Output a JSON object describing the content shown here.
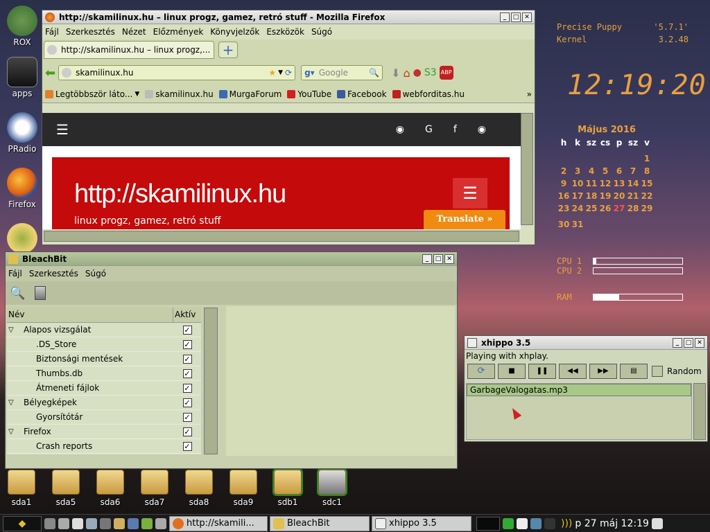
{
  "desktop": {
    "icons": [
      {
        "label": "ROX"
      },
      {
        "label": "apps"
      },
      {
        "label": "PRadio"
      },
      {
        "label": "Firefox"
      }
    ],
    "drives": [
      "sda1",
      "sda5",
      "sda6",
      "sda7",
      "sda8",
      "sda9",
      "sdb1",
      "sdc1"
    ]
  },
  "conky": {
    "os_name": "Precise Puppy",
    "os_version": "'5.7.1'",
    "kernel_label": "Kernel",
    "kernel_version": "3.2.48",
    "clock": "12:19:20",
    "calendar_title": "Május  2016",
    "weekdays": [
      "h",
      "k",
      "sz",
      "cs",
      "p",
      "sz",
      "v"
    ],
    "weeks": [
      [
        "",
        "",
        "",
        "",
        "",
        "",
        "1"
      ],
      [
        "2",
        "3",
        "4",
        "5",
        "6",
        "7",
        "8"
      ],
      [
        "9",
        "10",
        "11",
        "12",
        "13",
        "14",
        "15"
      ],
      [
        "16",
        "17",
        "18",
        "19",
        "20",
        "21",
        "22"
      ],
      [
        "23",
        "24",
        "25",
        "26",
        "27",
        "28",
        "29"
      ],
      [
        "30",
        "31",
        "",
        "",
        "",
        "",
        ""
      ]
    ],
    "today": "27",
    "cpu1_label": "CPU 1",
    "cpu2_label": "CPU 2",
    "ram_label": "RAM",
    "cpu1_usage": 0.03,
    "cpu2_usage": 0.0,
    "ram_usage": 0.29
  },
  "firefox": {
    "title": "http://skamilinux.hu – linux progz, gamez, retró stuff - Mozilla Firefox",
    "menu": [
      "Fájl",
      "Szerkesztés",
      "Nézet",
      "Előzmények",
      "Könyvjelzők",
      "Eszközök",
      "Súgó"
    ],
    "tab_label": "http://skamilinux.hu – linux progz,...",
    "url": "skamilinux.hu",
    "search_placeholder": "Google",
    "bookmarks": [
      "Legtöbbször láto...",
      "skamilinux.hu",
      "MurgaForum",
      "YouTube",
      "Facebook",
      "webforditas.hu"
    ],
    "page_heading": "http://skamilinux.hu",
    "page_subheading": "linux progz, gamez, retró stuff",
    "translate_label": "Translate »"
  },
  "bleachbit": {
    "title": "BleachBit",
    "menu": [
      "Fájl",
      "Szerkesztés",
      "Súgó"
    ],
    "col_name": "Név",
    "col_active": "Aktív",
    "rows": [
      {
        "label": "Alapos vizsgálat",
        "level": 0,
        "expander": "▽"
      },
      {
        "label": ".DS_Store",
        "level": 1,
        "expander": ""
      },
      {
        "label": "Biztonsági mentések",
        "level": 1,
        "expander": ""
      },
      {
        "label": "Thumbs.db",
        "level": 1,
        "expander": ""
      },
      {
        "label": "Átmeneti fájlok",
        "level": 1,
        "expander": ""
      },
      {
        "label": "Bélyegképek",
        "level": 0,
        "expander": "▽"
      },
      {
        "label": "Gyorsítótár",
        "level": 1,
        "expander": ""
      },
      {
        "label": "Firefox",
        "level": 0,
        "expander": "▽"
      },
      {
        "label": "Crash reports",
        "level": 1,
        "expander": ""
      }
    ]
  },
  "xhippo": {
    "title": "xhippo 3.5",
    "status": "Playing with xhplay.",
    "random_label": "Random",
    "playlist": [
      "GarbageValogatas.mp3"
    ]
  },
  "taskbar": {
    "tasks": [
      "http://skamili...",
      "BleachBit",
      "xhippo 3.5"
    ],
    "clock": "p 27 máj 12:19"
  }
}
